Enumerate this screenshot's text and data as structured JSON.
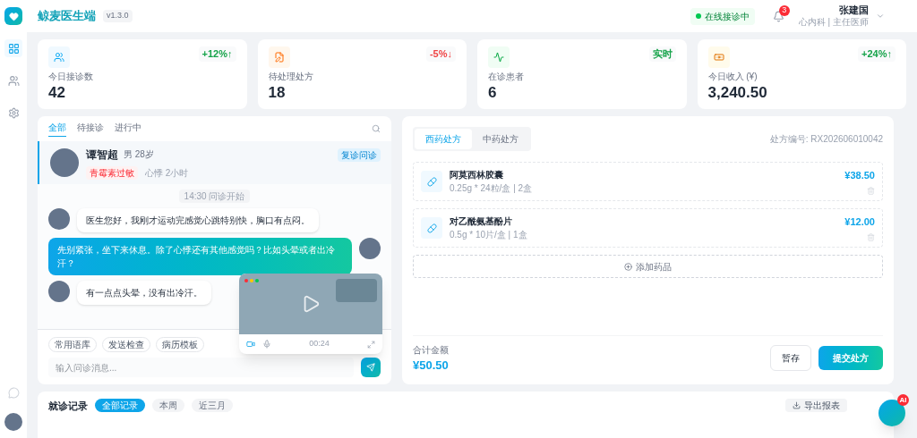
{
  "app": {
    "title": "鲸麦医生端",
    "version": "v1.3.0"
  },
  "header": {
    "status": "在线接诊中",
    "notifications": "3",
    "user": {
      "name": "张建国",
      "subtitle": "心内科 | 主任医师"
    }
  },
  "sidebar": {
    "items": [
      {
        "selected": true
      },
      {
        "selected": false
      },
      {
        "selected": false
      }
    ]
  },
  "stats": [
    {
      "label": "今日接诊数",
      "value": "42",
      "trend": {
        "text": "+12%↑",
        "color": "#16a34a"
      }
    },
    {
      "label": "待处理处方",
      "value": "18",
      "trend": {
        "text": "-5%↓",
        "color": "#ef4444"
      }
    },
    {
      "label": "在诊患者",
      "value": "6",
      "trend": {
        "text": "实时",
        "color": "#16a34a"
      }
    },
    {
      "label": "今日收入 (¥)",
      "value": "3,240.50",
      "trend": {
        "text": "+24%↑",
        "color": "#16a34a"
      }
    }
  ],
  "consult": {
    "tabs": [
      {
        "label": "全部",
        "selected": true
      },
      {
        "label": "待接诊",
        "selected": false
      },
      {
        "label": "进行中",
        "selected": false
      }
    ],
    "patient": {
      "name": "谭智超",
      "info": "男 28岁",
      "allergy": "青霉素过敏",
      "complaint": "心悸 2小时",
      "badge": "复诊问诊"
    },
    "messages": [
      {
        "kind": "system",
        "text": "14:30 问诊开始"
      },
      {
        "kind": "patient",
        "text": "医生您好，我刚才运动完感觉心跳特别快，胸口有点闷。"
      },
      {
        "kind": "doctor",
        "text": "先别紧张，坐下来休息。除了心悸还有其他感觉吗？比如头晕或者出冷汗？"
      },
      {
        "kind": "patient",
        "text": "有一点点头晕，没有出冷汗。"
      }
    ],
    "quick_replies": [
      "常用语库",
      "发送检查",
      "病历模板"
    ],
    "input": {
      "placeholder": "输入问诊消息..."
    },
    "video": {
      "timer": "00:24"
    }
  },
  "prescription": {
    "tabs": [
      {
        "label": "西药处方",
        "selected": true
      },
      {
        "label": "中药处方",
        "selected": false
      }
    ],
    "number": "处方编号: RX202606010042",
    "drugs": [
      {
        "name": "阿莫西林胶囊",
        "spec": "0.25g * 24粒/盒 | 2盒",
        "price": "¥38.50"
      },
      {
        "name": "对乙酰氨基酚片",
        "spec": "0.5g * 10片/盒 | 1盒",
        "price": "¥12.00"
      }
    ],
    "add": "添加药品",
    "total_label": "合计金额",
    "total": "¥50.50",
    "buttons": [
      "暂存",
      "提交处方"
    ]
  },
  "records": {
    "title": "就诊记录",
    "filters": [
      {
        "label": "全部记录",
        "selected": true
      },
      {
        "label": "本周",
        "selected": false
      },
      {
        "label": "近三月",
        "selected": false
      }
    ],
    "export": "导出报表"
  },
  "assistant": {
    "badge": "AI"
  }
}
